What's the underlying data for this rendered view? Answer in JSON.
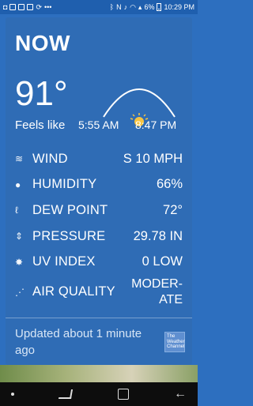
{
  "status_bar": {
    "battery_percent": "6%",
    "time": "10:29 PM"
  },
  "weather": {
    "title": "NOW",
    "temperature": "91°",
    "feels_like_label": "Feels like",
    "sunrise": "5:55 AM",
    "sunset": "8:47 PM",
    "details": [
      {
        "icon": "wind-icon",
        "label": "WIND",
        "value": "S 10 MPH"
      },
      {
        "icon": "humidity-icon",
        "label": "HUMIDITY",
        "value": "66%"
      },
      {
        "icon": "dew-point-icon",
        "label": "DEW POINT",
        "value": "72°"
      },
      {
        "icon": "pressure-icon",
        "label": "PRESSURE",
        "value": "29.78 IN"
      },
      {
        "icon": "uv-index-icon",
        "label": "UV INDEX",
        "value": "0 LOW"
      },
      {
        "icon": "air-quality-icon",
        "label": "AIR QUALITY",
        "value_line1": "MODER-",
        "value_line2": "ATE"
      }
    ],
    "updated": "Updated about 1 minute ago",
    "logo_text": "The Weather Channel"
  }
}
